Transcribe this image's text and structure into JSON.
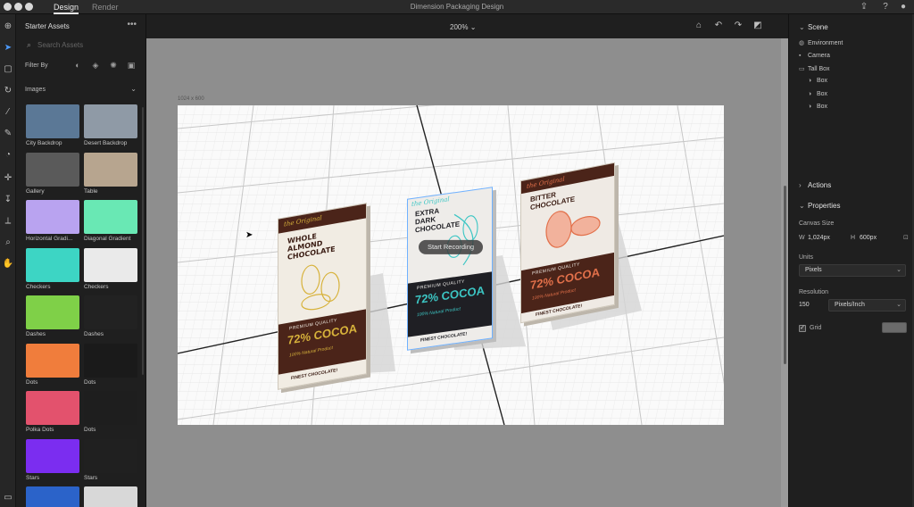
{
  "titlebar": {
    "tabs": [
      {
        "label": "Design",
        "active": true
      },
      {
        "label": "Render",
        "active": false
      }
    ],
    "document_title": "Dimension Packaging Design"
  },
  "toolbar": {
    "tools": [
      "add-icon",
      "select-icon",
      "move-icon",
      "orbit-icon",
      "magic-wand-icon",
      "sample-icon",
      "paint-bucket-icon",
      "pan-icon",
      "dolly-icon",
      "horizon-icon",
      "zoom-icon",
      "hand-icon"
    ]
  },
  "assets": {
    "title": "Starter Assets",
    "search_placeholder": "Search Assets",
    "filter_label": "Filter By",
    "category": "Images",
    "tiles": [
      {
        "label": "City Backdrop",
        "color": "#5b7896"
      },
      {
        "label": "Desert Backdrop",
        "color": "#8f9aa6"
      },
      {
        "label": "Gallery",
        "color": "#5a5a5a"
      },
      {
        "label": "Table",
        "color": "#b7a58f"
      },
      {
        "label": "Horizontal Gradi...",
        "color": "#b9a3f0"
      },
      {
        "label": "Diagonal Gradient",
        "color": "#69e8b4"
      },
      {
        "label": "Checkers",
        "color": "#3dd5c4"
      },
      {
        "label": "Checkers",
        "color": "#eaeaea"
      },
      {
        "label": "Dashes",
        "color": "#7fd048"
      },
      {
        "label": "Dashes",
        "color": "#222222"
      },
      {
        "label": "Dots",
        "color": "#f07d3c"
      },
      {
        "label": "Dots",
        "color": "#1a1a1a"
      },
      {
        "label": "Polka Dots",
        "color": "#e3526d"
      },
      {
        "label": "Dots",
        "color": "#1e1e1e"
      },
      {
        "label": "Stars",
        "color": "#7b2df0"
      },
      {
        "label": "Stars",
        "color": "#202020"
      },
      {
        "label": "",
        "color": "#2b63c9"
      },
      {
        "label": "",
        "color": "#d8d8d8"
      }
    ]
  },
  "canvas": {
    "zoom": "200%",
    "size_label": "1024 x 600",
    "record_button": "Start Recording"
  },
  "packages": [
    {
      "brand": "the Original",
      "title_lines": [
        "WHOLE",
        "ALMOND",
        "CHOCOLATE"
      ],
      "quality": "PREMIUM QUALITY",
      "percent": "72% COCOA",
      "natural": "100% Natural Product",
      "finest": "FINEST CHOCOLATE!",
      "accent": "#d7b23b",
      "band": "#4b2419"
    },
    {
      "brand": "the Original",
      "title_lines": [
        "EXTRA",
        "DARK",
        "CHOCOLATE"
      ],
      "quality": "PREMIUM QUALITY",
      "percent": "72% COCOA",
      "natural": "100% Natural Product",
      "finest": "FINEST CHOCOLATE!",
      "accent": "#3cc6c4",
      "band": "#1f1f24"
    },
    {
      "brand": "the Original",
      "title_lines": [
        "BITTER",
        "CHOCOLATE"
      ],
      "quality": "PREMIUM QUALITY",
      "percent": "72% COCOA",
      "natural": "100% Natural Product",
      "finest": "FINEST CHOCOLATE!",
      "accent": "#e2704a",
      "band": "#4b2419"
    }
  ],
  "right_panel": {
    "scene_title": "Scene",
    "scene_items": [
      {
        "label": "Environment",
        "icon": "globe-icon"
      },
      {
        "label": "Camera",
        "icon": "camera-icon"
      },
      {
        "label": "Tall Box",
        "icon": "folder-icon"
      },
      {
        "label": "Box",
        "icon": "model-icon"
      },
      {
        "label": "Box",
        "icon": "model-icon"
      },
      {
        "label": "Box",
        "icon": "model-icon"
      }
    ],
    "actions_title": "Actions",
    "properties_title": "Properties",
    "canvas_size_label": "Canvas Size",
    "width_label": "W",
    "width_value": "1,024px",
    "height_label": "H",
    "height_value": "600px",
    "units_label": "Units",
    "units_value": "Pixels",
    "resolution_label": "Resolution",
    "resolution_value": "150",
    "resolution_unit": "Pixels/Inch",
    "grid_label": "Grid",
    "grid_checked": true
  }
}
